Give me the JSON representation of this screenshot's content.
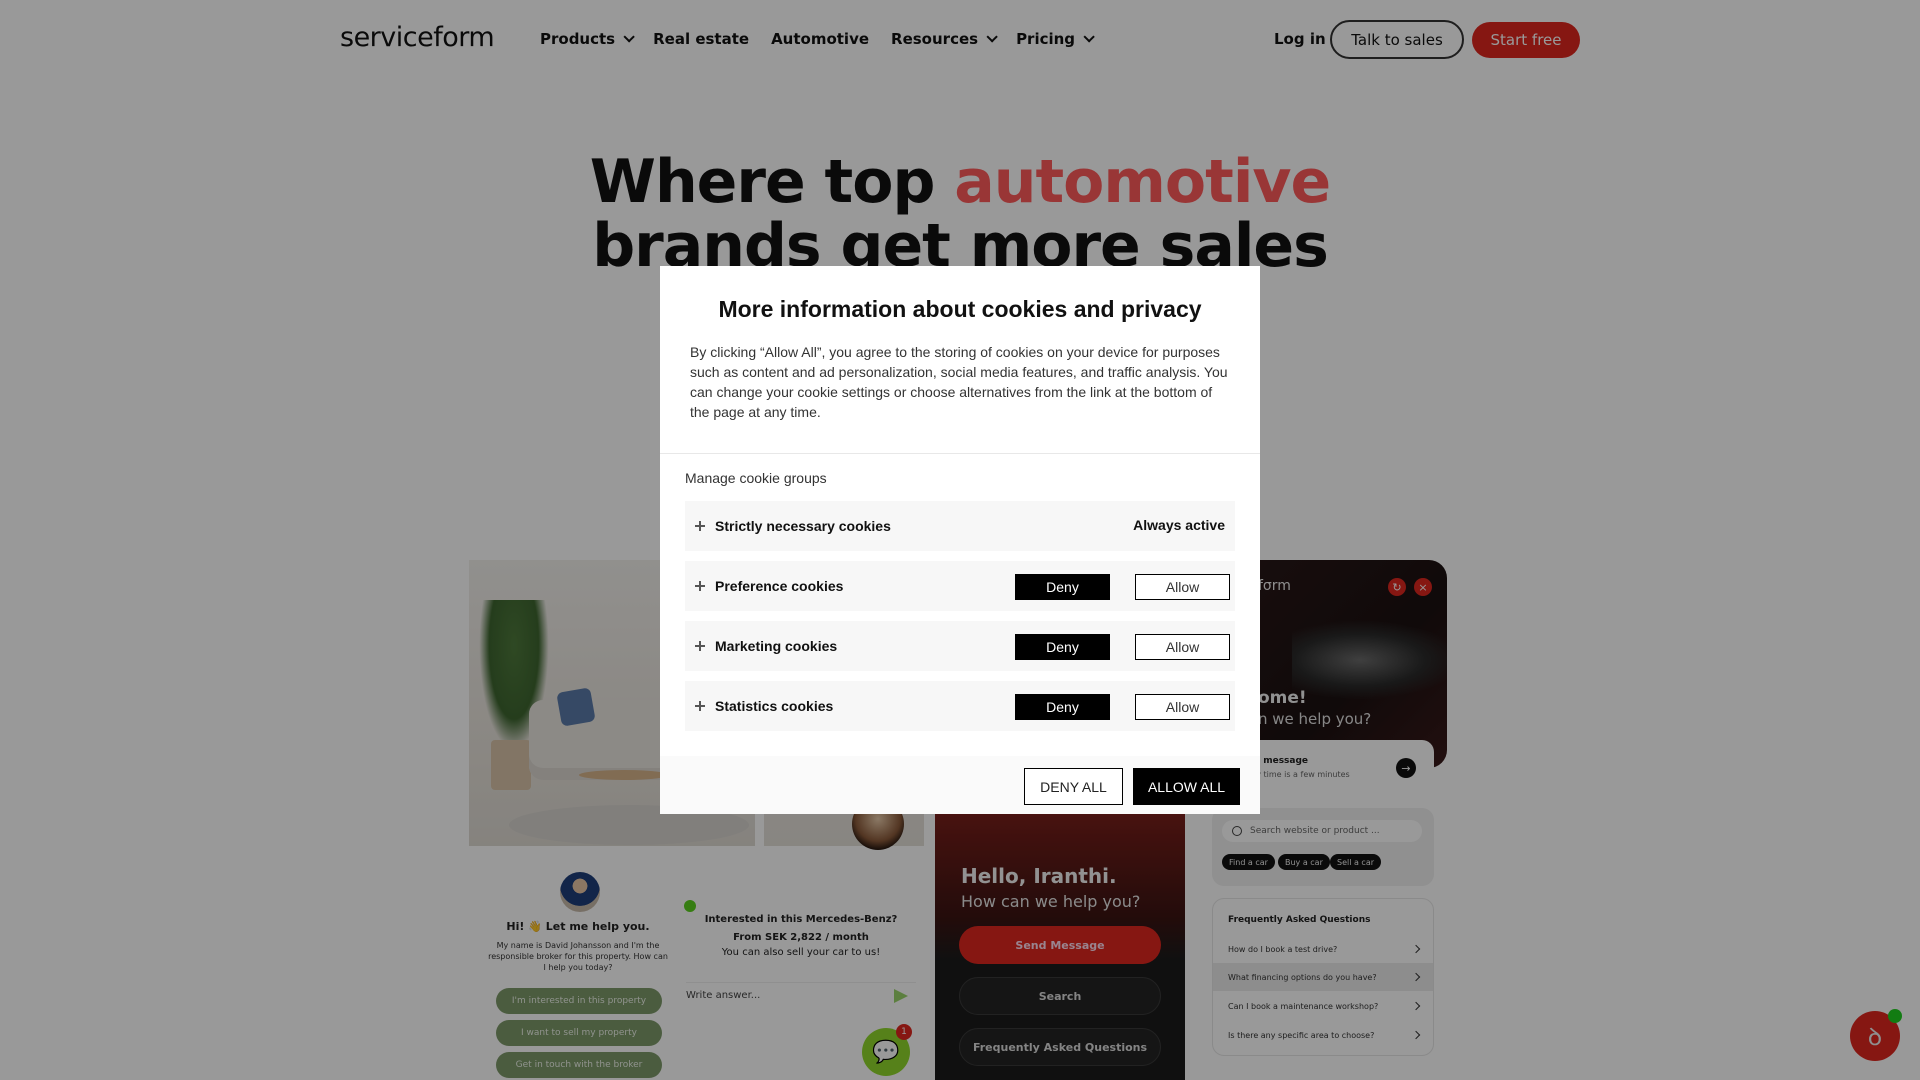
{
  "nav": {
    "logo": "serviceform",
    "links": [
      {
        "label": "Products",
        "dropdown": true
      },
      {
        "label": "Real estate",
        "dropdown": false
      },
      {
        "label": "Automotive",
        "dropdown": false
      },
      {
        "label": "Resources",
        "dropdown": true
      },
      {
        "label": "Pricing",
        "dropdown": true
      }
    ],
    "login": "Log in",
    "talk_to_sales": "Talk to sales",
    "start_free": "Start free"
  },
  "hero": {
    "line1_prefix": "Where top ",
    "line1_accent": "automotive",
    "line2": "brands get more sales",
    "accent_color": "#ff5a5a"
  },
  "showcase": {
    "broker": {
      "title": "Hi! 👋 Let me help you.",
      "text": "My name is David Johansson and I'm the responsible broker for this property. How can I help you today?",
      "buttons": [
        "I'm interested in this property",
        "I want to sell my property",
        "Get in touch with the broker"
      ]
    },
    "mercedes": {
      "line1": "Interested in this Mercedes-Benz?",
      "line2": "From SEK 2,822 / month",
      "line3": "You can also sell your car to us!",
      "input_placeholder": "Write answer...",
      "badge_count": "1"
    },
    "dark_widget": {
      "hello": "Hello, Iranthi.",
      "sub": "How can we help you?",
      "buttons": [
        "Send Message",
        "Search",
        "Frequently Asked Questions"
      ]
    },
    "car_widget": {
      "logo": "fσrm",
      "headline": "ome!",
      "sub": "n we help you?",
      "msg_title": "a message",
      "msg_sub": "ly time is a few minutes",
      "search_placeholder": "Search website or product ...",
      "chips": [
        "Find a car",
        "Buy a car",
        "Sell a car"
      ],
      "faq_title": "Frequently Asked Questions",
      "faq": [
        "How do I book a test drive?",
        "What financing options do you have?",
        "Can I book a maintenance workshop?",
        "Is there any specific area to choose?"
      ]
    }
  },
  "cookie_modal": {
    "title": "More information about cookies and privacy",
    "description": "By clicking “Allow All”, you agree to the storing of cookies on your device for purposes such as content and ad personalization, social media features, and traffic analysis. You can change your cookie settings or choose alternatives from the link at the bottom of the page at any time.",
    "manage_label": "Manage cookie groups",
    "groups": [
      {
        "label": "Strictly necessary cookies",
        "status": "Always active"
      },
      {
        "label": "Preference cookies",
        "deny": "Deny",
        "allow": "Allow"
      },
      {
        "label": "Marketing cookies",
        "deny": "Deny",
        "allow": "Allow"
      },
      {
        "label": "Statistics cookies",
        "deny": "Deny",
        "allow": "Allow"
      }
    ],
    "deny_all": "DENY ALL",
    "allow_all": "ALLOW ALL"
  }
}
